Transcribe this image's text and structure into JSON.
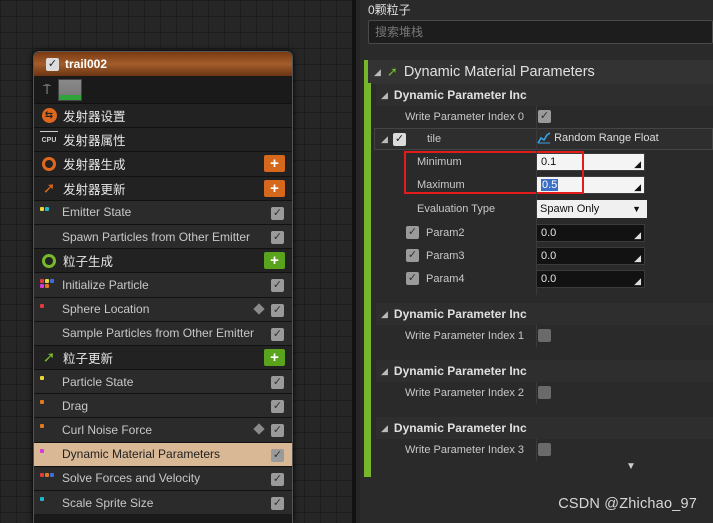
{
  "node": {
    "title": "trail002",
    "rows": [
      {
        "label": "发射器设置",
        "type": "section",
        "icon": "emitter-settings-icon",
        "color": "#e0681e"
      },
      {
        "label": "发射器属性",
        "type": "section",
        "icon": "cpu-icon",
        "color": "#cfcfcf",
        "icon_text": "CPU"
      },
      {
        "label": "发射器生成",
        "type": "section",
        "icon": "emitter-spawn-icon",
        "color": "#e0681e",
        "plus": "orange"
      },
      {
        "label": "发射器更新",
        "type": "section",
        "icon": "emitter-update-icon",
        "color": "#e0681e",
        "plus": "orange"
      },
      {
        "label": "Emitter State",
        "type": "module",
        "dots": [
          "#e8d63a",
          "#1fb8c9"
        ],
        "checked": true
      },
      {
        "label": "Spawn Particles from Other Emitter",
        "type": "module",
        "dots": [],
        "checked": true
      },
      {
        "label": "粒子生成",
        "type": "section",
        "icon": "particle-spawn-icon",
        "color": "#76b82a",
        "plus": "green"
      },
      {
        "label": "Initialize Particle",
        "type": "module",
        "dots": [
          "#e03b3b",
          "#e8d63a",
          "#3b6fe0",
          "#d63ad6",
          "#e07a1e"
        ],
        "checked": true
      },
      {
        "label": "Sphere Location",
        "type": "module",
        "dots": [
          "#e03b3b"
        ],
        "checked": true,
        "cube": true
      },
      {
        "label": "Sample Particles from Other Emitter",
        "type": "module",
        "dots": [],
        "checked": true
      },
      {
        "label": "粒子更新",
        "type": "section",
        "icon": "particle-update-icon",
        "color": "#76b82a",
        "plus": "green"
      },
      {
        "label": "Particle State",
        "type": "module",
        "dots": [
          "#e8d63a"
        ],
        "checked": true
      },
      {
        "label": "Drag",
        "type": "module",
        "dots": [
          "#e07a1e"
        ],
        "checked": true
      },
      {
        "label": "Curl Noise Force",
        "type": "module",
        "dots": [
          "#e07a1e"
        ],
        "checked": true,
        "cube": true
      },
      {
        "label": "Dynamic Material Parameters",
        "type": "module",
        "dots": [
          "#d63ad6"
        ],
        "checked": true,
        "selected": true
      },
      {
        "label": "Solve Forces and Velocity",
        "type": "module",
        "dots": [
          "#e03b3b",
          "#e07a1e",
          "#3b6fe0"
        ],
        "checked": true
      },
      {
        "label": "Scale Sprite Size",
        "type": "module",
        "dots": [
          "#1fb8c9"
        ],
        "checked": true
      }
    ]
  },
  "panel": {
    "stack_title": "0颗粒子",
    "search_placeholder": "搜索堆栈",
    "category_title": "Dynamic Material Parameters",
    "group0": {
      "header": "Dynamic Parameter Inc",
      "write_label": "Write Parameter Index 0",
      "tile_label": "tile",
      "tile_value": "Random Range Float",
      "minimum_label": "Minimum",
      "minimum_value": "0.1",
      "maximum_label": "Maximum",
      "maximum_value": "0.5",
      "eval_label": "Evaluation Type",
      "eval_value": "Spawn Only",
      "params": [
        {
          "label": "Param2",
          "value": "0.0"
        },
        {
          "label": "Param3",
          "value": "0.0"
        },
        {
          "label": "Param4",
          "value": "0.0"
        }
      ]
    },
    "groups": [
      {
        "header": "Dynamic Parameter Inc",
        "write_label": "Write Parameter Index 1"
      },
      {
        "header": "Dynamic Parameter Inc",
        "write_label": "Write Parameter Index 2"
      },
      {
        "header": "Dynamic Parameter Inc",
        "write_label": "Write Parameter Index 3"
      }
    ]
  },
  "watermark": "CSDN @Zhichao_97",
  "colors": {
    "accent_green": "#76b82a",
    "accent_orange": "#e0681e",
    "highlight_box": "#e21b1b",
    "selected_row": "#d9b896"
  }
}
